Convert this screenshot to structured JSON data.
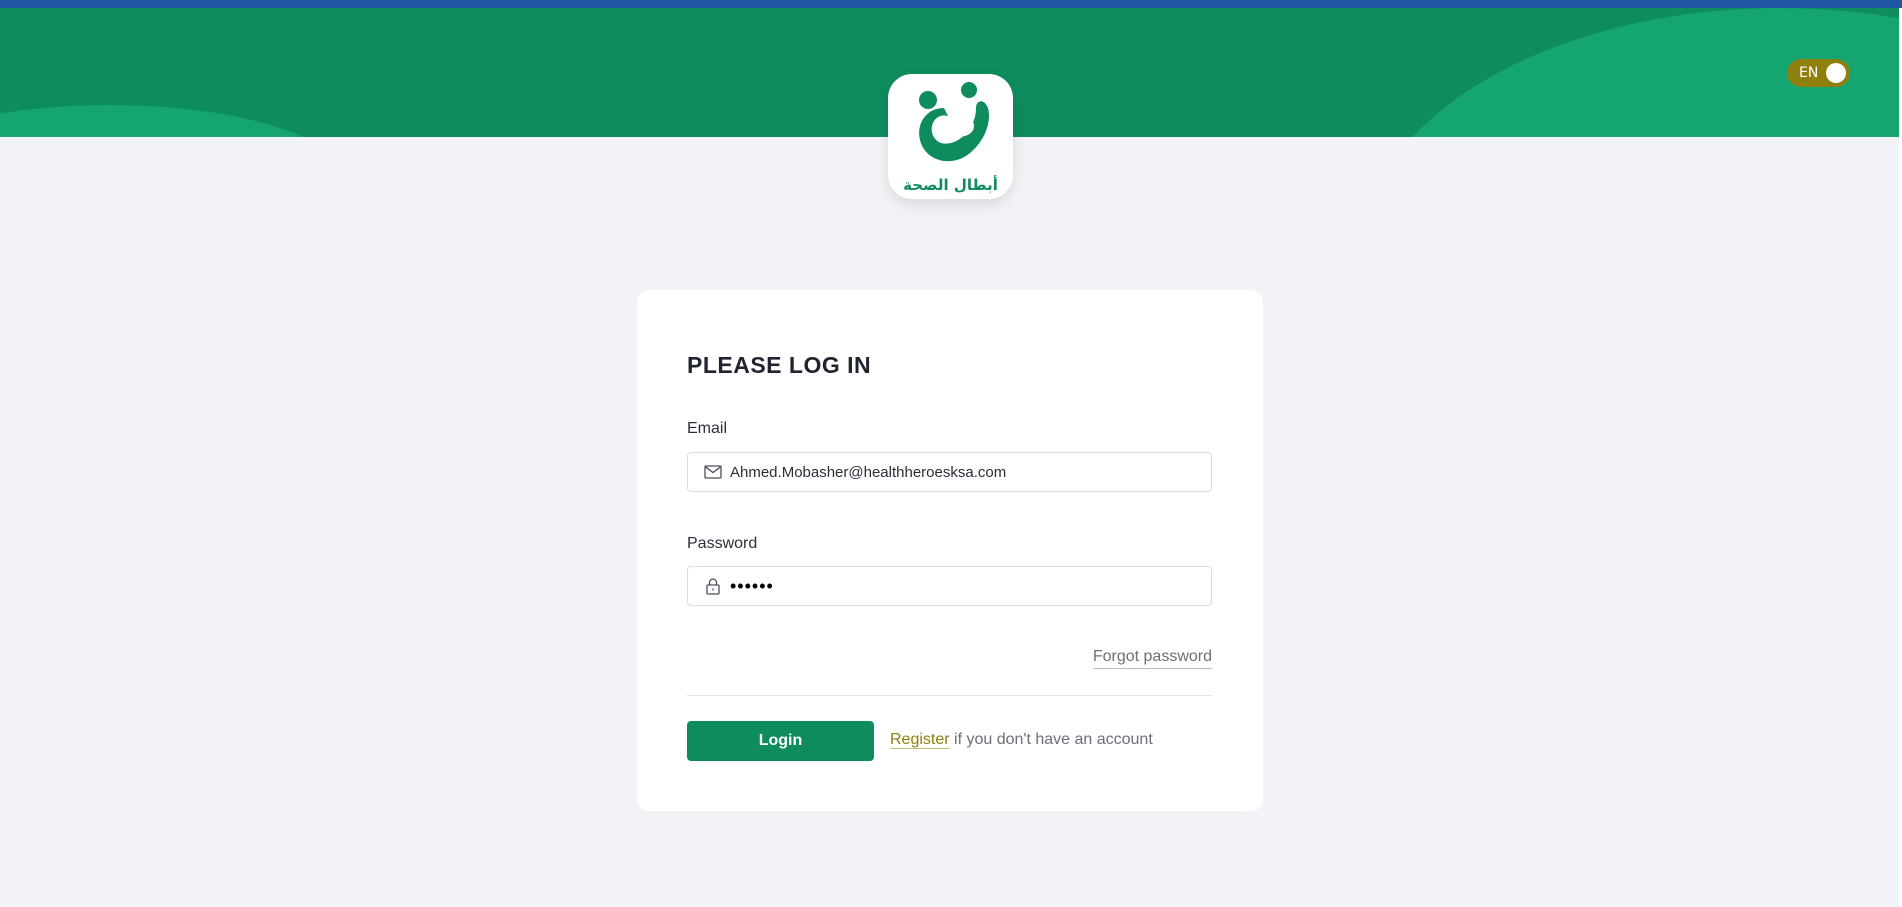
{
  "header": {
    "language_toggle_label": "EN",
    "logo_text": "أبطال الصحة"
  },
  "login": {
    "title": "PLEASE LOG IN",
    "email_label": "Email",
    "email_value": "Ahmed.Mobasher@healthheroesksa.com",
    "password_label": "Password",
    "password_value": "••••••",
    "forgot_password_label": "Forgot password",
    "login_button_label": "Login",
    "register_link_label": "Register",
    "register_suffix": " if you don't have an account"
  },
  "icons": {
    "email": "envelope-icon",
    "password": "lock-icon"
  },
  "colors": {
    "brand_green": "#0f8c5e",
    "light_green": "#14a571",
    "accent_olive": "#8f7f0d",
    "top_strip": "#1f56a3",
    "page_background": "#f2f3f6"
  }
}
